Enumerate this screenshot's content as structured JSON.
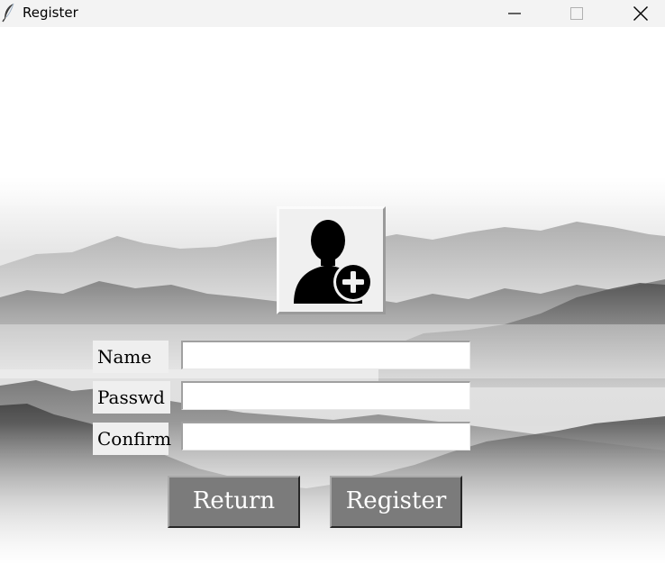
{
  "window": {
    "title": "Register",
    "controls": {
      "minimize_icon": "minimize-icon",
      "maximize_icon": "maximize-icon",
      "close_icon": "close-icon"
    }
  },
  "background": {
    "description_icon": "misty-mountains-landscape"
  },
  "avatar_button": {
    "icon": "add-user-icon"
  },
  "form": {
    "name_label": "Name",
    "password_label": "Passwd",
    "confirm_label": "Confirm",
    "name_value": "",
    "password_value": "",
    "confirm_value": ""
  },
  "actions": {
    "return_label": "Return",
    "register_label": "Register"
  },
  "colors": {
    "titlebar": "#f3f3f3",
    "button_bg": "#7b7b7b",
    "button_text": "#ffffff",
    "label_bg": "#efefef"
  }
}
